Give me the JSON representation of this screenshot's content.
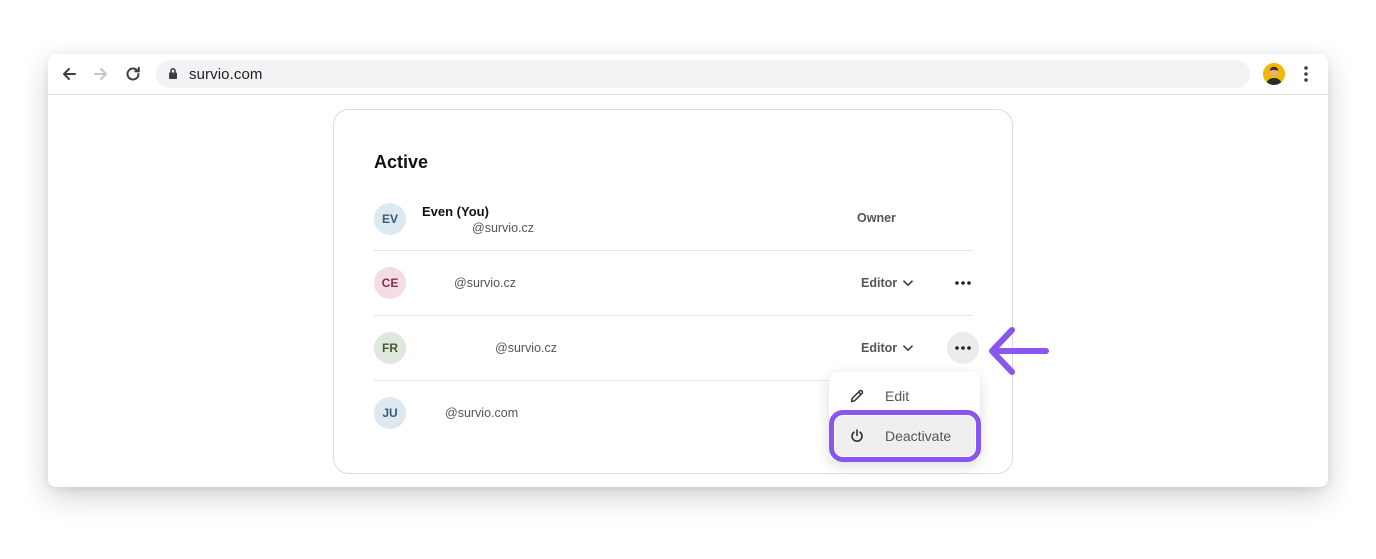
{
  "browser": {
    "url": "survio.com",
    "icons": {
      "back": "arrow-left-icon",
      "forward": "arrow-right-icon",
      "reload": "reload-icon",
      "lock": "lock-icon",
      "menu": "kebab-menu-icon"
    }
  },
  "members": {
    "section_title": "Active",
    "rows": [
      {
        "initials": "EV",
        "name": "Even (You)",
        "email": "@survio.cz",
        "role": "Owner",
        "avatar_bg": "#dbe9f1",
        "avatar_fg": "#3b5b73"
      },
      {
        "initials": "CE",
        "name": "",
        "email": "@survio.cz",
        "role": "Editor",
        "avatar_bg": "#f2dde4",
        "avatar_fg": "#8b2f4b"
      },
      {
        "initials": "FR",
        "name": "",
        "email": "@survio.cz",
        "role": "Editor",
        "avatar_bg": "#dfe8dc",
        "avatar_fg": "#3f5a3a"
      },
      {
        "initials": "JU",
        "name": "",
        "email": "@survio.com",
        "role": "",
        "avatar_bg": "#dde8f1",
        "avatar_fg": "#3b5b73"
      }
    ]
  },
  "context_menu": {
    "edit_label": "Edit",
    "deactivate_label": "Deactivate"
  },
  "colors": {
    "accent": "#8a56f0",
    "border": "#dcdcdc"
  }
}
